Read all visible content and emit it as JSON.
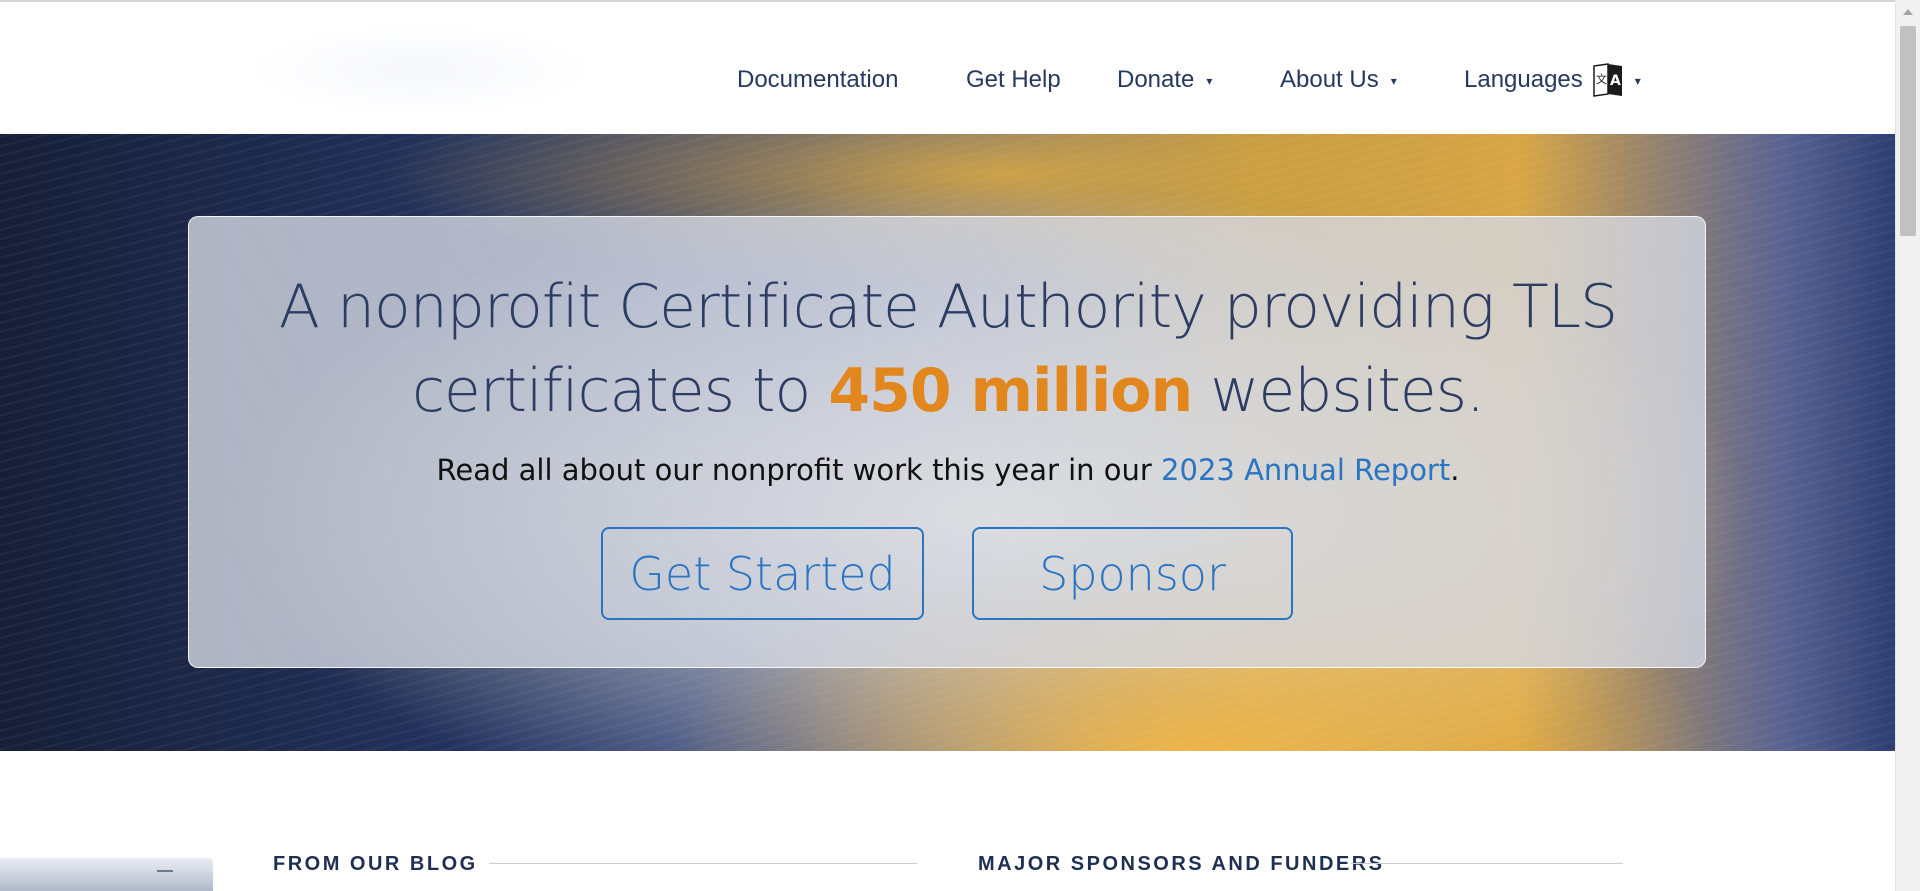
{
  "nav": {
    "items": [
      {
        "label": "Documentation"
      },
      {
        "label": "Get Help"
      },
      {
        "label": "Donate",
        "caret": "▾"
      },
      {
        "label": "About Us",
        "caret": "▾"
      },
      {
        "label": "Languages",
        "caret": "▾",
        "icon": "translate-icon"
      }
    ]
  },
  "hero": {
    "headline_part1": "A nonprofit Certificate Authority providing TLS",
    "headline_part2": "certificates to",
    "headline_highlight": "450 million",
    "headline_part3": "websites.",
    "subline_text": "Read all about our nonprofit work this year in our",
    "subline_link": "2023 Annual Report",
    "subline_end": ".",
    "btn_get_started": "Get Started",
    "btn_sponsor": "Sponsor"
  },
  "sections": {
    "blog_title": "FROM OUR BLOG",
    "sponsors_title": "MAJOR SPONSORS AND FUNDERS"
  },
  "colors": {
    "nav_text": "#26395e",
    "highlight": "#e1871e",
    "link": "#2a75c2",
    "headline": "#2c3c63"
  }
}
